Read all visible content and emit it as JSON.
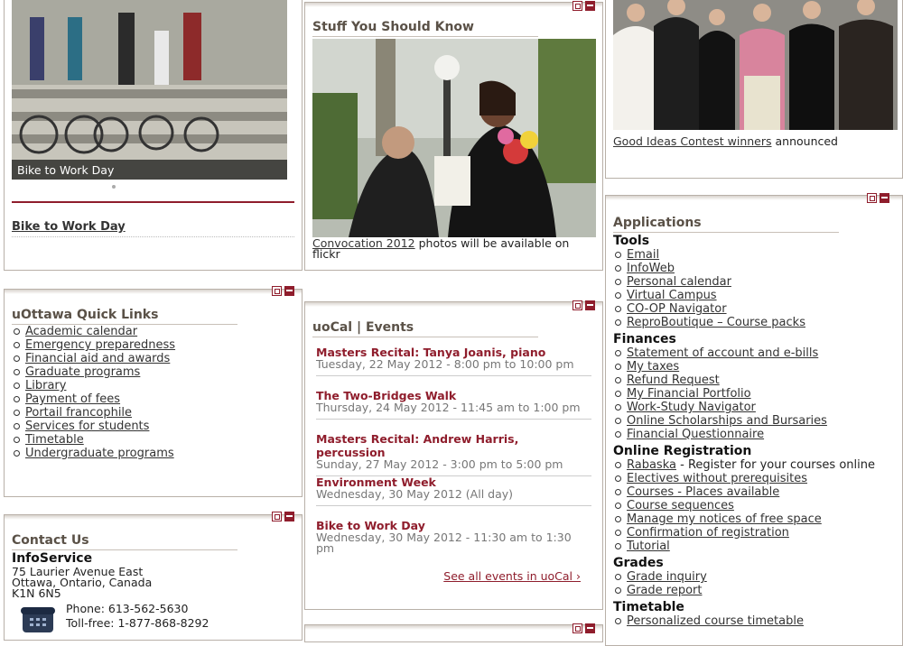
{
  "col1": {
    "bike": {
      "caption": "Bike to Work Day",
      "link": "Bike to Work Day"
    },
    "quick_links": {
      "title": "uOttawa Quick Links",
      "items": [
        "Academic calendar",
        "Emergency preparedness",
        "Financial aid and awards",
        "Graduate programs",
        "Library",
        "Payment of fees",
        "Portail francophile",
        "Services for students",
        "Timetable",
        "Undergraduate programs"
      ]
    },
    "contact": {
      "title": "Contact Us",
      "name": "InfoService",
      "address1": "75 Laurier Avenue East",
      "address2": "Ottawa, Ontario, Canada",
      "postal": "K1N 6N5",
      "phone": "Phone: 613-562-5630",
      "tollfree": "Toll-free: 1-877-868-8292"
    }
  },
  "col2": {
    "stuff": {
      "title": "Stuff You Should Know",
      "link": "Convocation 2012",
      "rest": " photos will be available on flickr"
    },
    "events": {
      "title": "uoCal | Events",
      "items": [
        {
          "title": "Masters Recital: Tanya Joanis, piano",
          "date": "Tuesday, 22 May 2012 - 8:00 pm to 10:00 pm"
        },
        {
          "title": "The Two-Bridges Walk",
          "date": "Thursday, 24 May 2012 - 11:45 am to 1:00 pm"
        },
        {
          "title": "Masters Recital: Andrew Harris, percussion",
          "date": "Sunday, 27 May 2012 - 3:00 pm to 5:00 pm"
        },
        {
          "title": "Environment Week",
          "date": "Wednesday, 30 May 2012 (All day)"
        },
        {
          "title": "Bike to Work Day",
          "date": "Wednesday, 30 May 2012 - 11:30 am to 1:30 pm"
        }
      ],
      "see_all": "See all events in uoCal ›"
    }
  },
  "col3": {
    "contest": {
      "link": "Good Ideas Contest winners",
      "rest": " announced"
    },
    "apps": {
      "title": "Applications",
      "tools": {
        "heading": "Tools",
        "items": [
          "Email",
          "InfoWeb",
          "Personal calendar",
          "Virtual Campus",
          "CO-OP Navigator",
          "ReproBoutique – Course packs"
        ]
      },
      "finances": {
        "heading": "Finances",
        "items": [
          "Statement of account and e-bills",
          "My taxes",
          "Refund Request",
          "My Financial Portfolio",
          "Work-Study Navigator",
          "Online Scholarships and Bursaries",
          "Financial Questionnaire"
        ]
      },
      "registration": {
        "heading": "Online Registration",
        "first_link": "Rabaska",
        "first_rest": " - Register for your courses online",
        "items": [
          "Electives without prerequisites",
          "Courses - Places available",
          "Course sequences",
          "Manage my notices of free space",
          "Confirmation of registration",
          "Tutorial"
        ]
      },
      "grades": {
        "heading": "Grades",
        "items": [
          "Grade inquiry",
          "Grade report"
        ]
      },
      "timetable": {
        "heading": "Timetable",
        "items": [
          "Personalized course timetable"
        ]
      }
    }
  },
  "colors": {
    "accent": "#8f1d2c",
    "title": "#5a5147"
  }
}
